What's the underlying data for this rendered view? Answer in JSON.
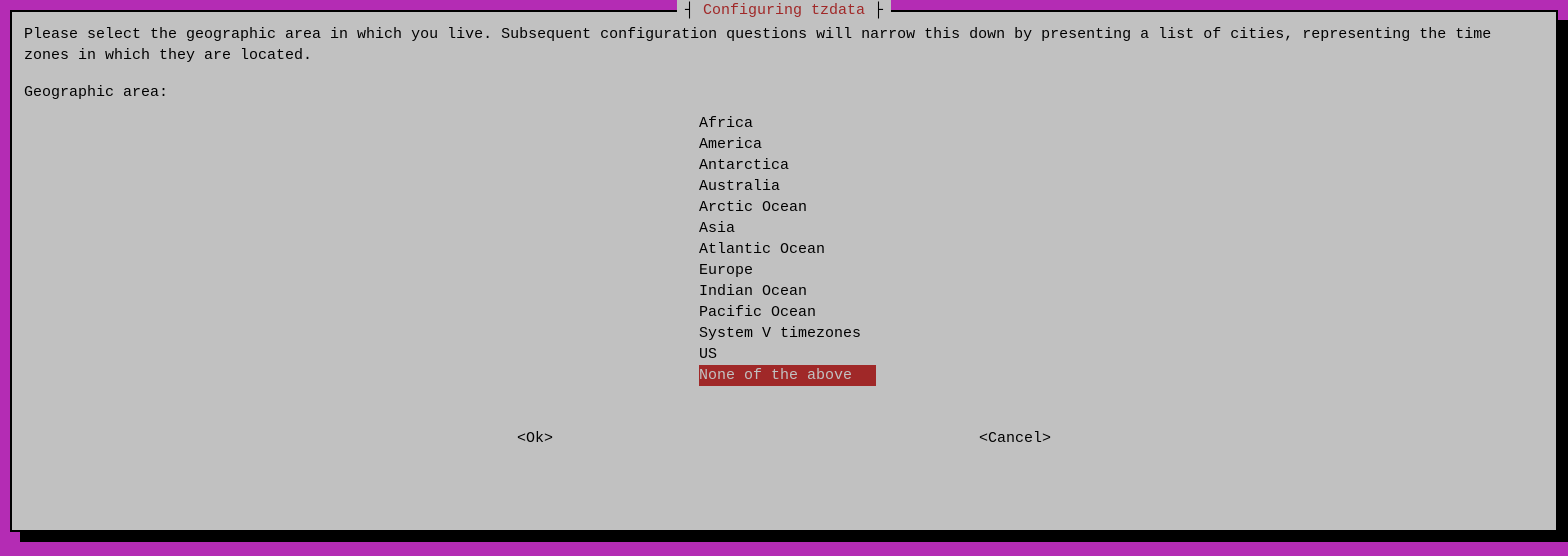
{
  "dialog": {
    "title": "Configuring tzdata",
    "prompt": "Please select the geographic area in which you live. Subsequent configuration questions will narrow this down by presenting a list of cities, representing the time zones in which they are located.",
    "field_label": "Geographic area:",
    "options": [
      "Africa",
      "America",
      "Antarctica",
      "Australia",
      "Arctic Ocean",
      "Asia",
      "Atlantic Ocean",
      "Europe",
      "Indian Ocean",
      "Pacific Ocean",
      "System V timezones",
      "US",
      "None of the above"
    ],
    "selected_index": 12,
    "buttons": {
      "ok": "<Ok>",
      "cancel": "<Cancel>"
    }
  },
  "colors": {
    "background": "#b42cb4",
    "dialog_bg": "#c1c1c1",
    "highlight_bg": "#a02828",
    "title_color": "#a02828"
  }
}
